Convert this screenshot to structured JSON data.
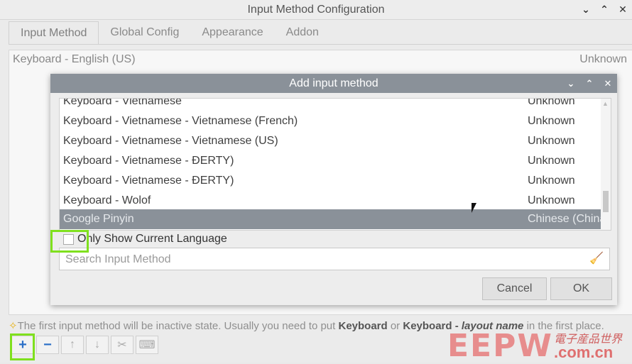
{
  "window": {
    "title": "Input Method Configuration",
    "controls": [
      "⌄",
      "⌃",
      "✕"
    ]
  },
  "tabs": [
    {
      "label": "Input Method"
    },
    {
      "label": "Global Config"
    },
    {
      "label": "Appearance"
    },
    {
      "label": "Addon"
    }
  ],
  "current_list": {
    "items": [
      {
        "name": "Keyboard - English (US)",
        "lang": "Unknown"
      }
    ]
  },
  "dialog": {
    "title": "Add input method",
    "controls": [
      "⌄",
      "⌃",
      "✕"
    ],
    "rows": [
      {
        "name": "Keyboard - Vietnamese",
        "lang": "Unknown"
      },
      {
        "name": "Keyboard - Vietnamese - Vietnamese (French)",
        "lang": "Unknown"
      },
      {
        "name": "Keyboard - Vietnamese - Vietnamese (US)",
        "lang": "Unknown"
      },
      {
        "name": "Keyboard - Vietnamese - ĐERTY)",
        "lang": "Unknown"
      },
      {
        "name": "Keyboard - Vietnamese - ĐERTY)",
        "lang": "Unknown"
      },
      {
        "name": "Keyboard - Wolof",
        "lang": "Unknown"
      },
      {
        "name": "Google Pinyin",
        "lang": "Chinese (China)"
      }
    ],
    "selected_index": 6,
    "checkbox_label": "Only Show Current Language",
    "search_placeholder": "Search Input Method",
    "cancel_label": "Cancel",
    "ok_label": "OK"
  },
  "hint": {
    "part1": "The first input method will be inactive state. Usually you need to put ",
    "bold1": "Keyboard",
    "part2": " or ",
    "bold2": "Keyboard - ",
    "italic": "layout name",
    "part3": " in the first place."
  },
  "toolbar": {
    "add": "+",
    "remove": "−",
    "up": "↑",
    "down": "↓",
    "configure": "✂",
    "keyboard": "⌨"
  },
  "watermark": {
    "big": "EEPW",
    "cn": "電子産品世界",
    "domain": ".com.cn"
  },
  "colors": {
    "highlight": "#7fe01e",
    "selected_row": "#8a9199",
    "dialog_title": "#8a9199"
  }
}
